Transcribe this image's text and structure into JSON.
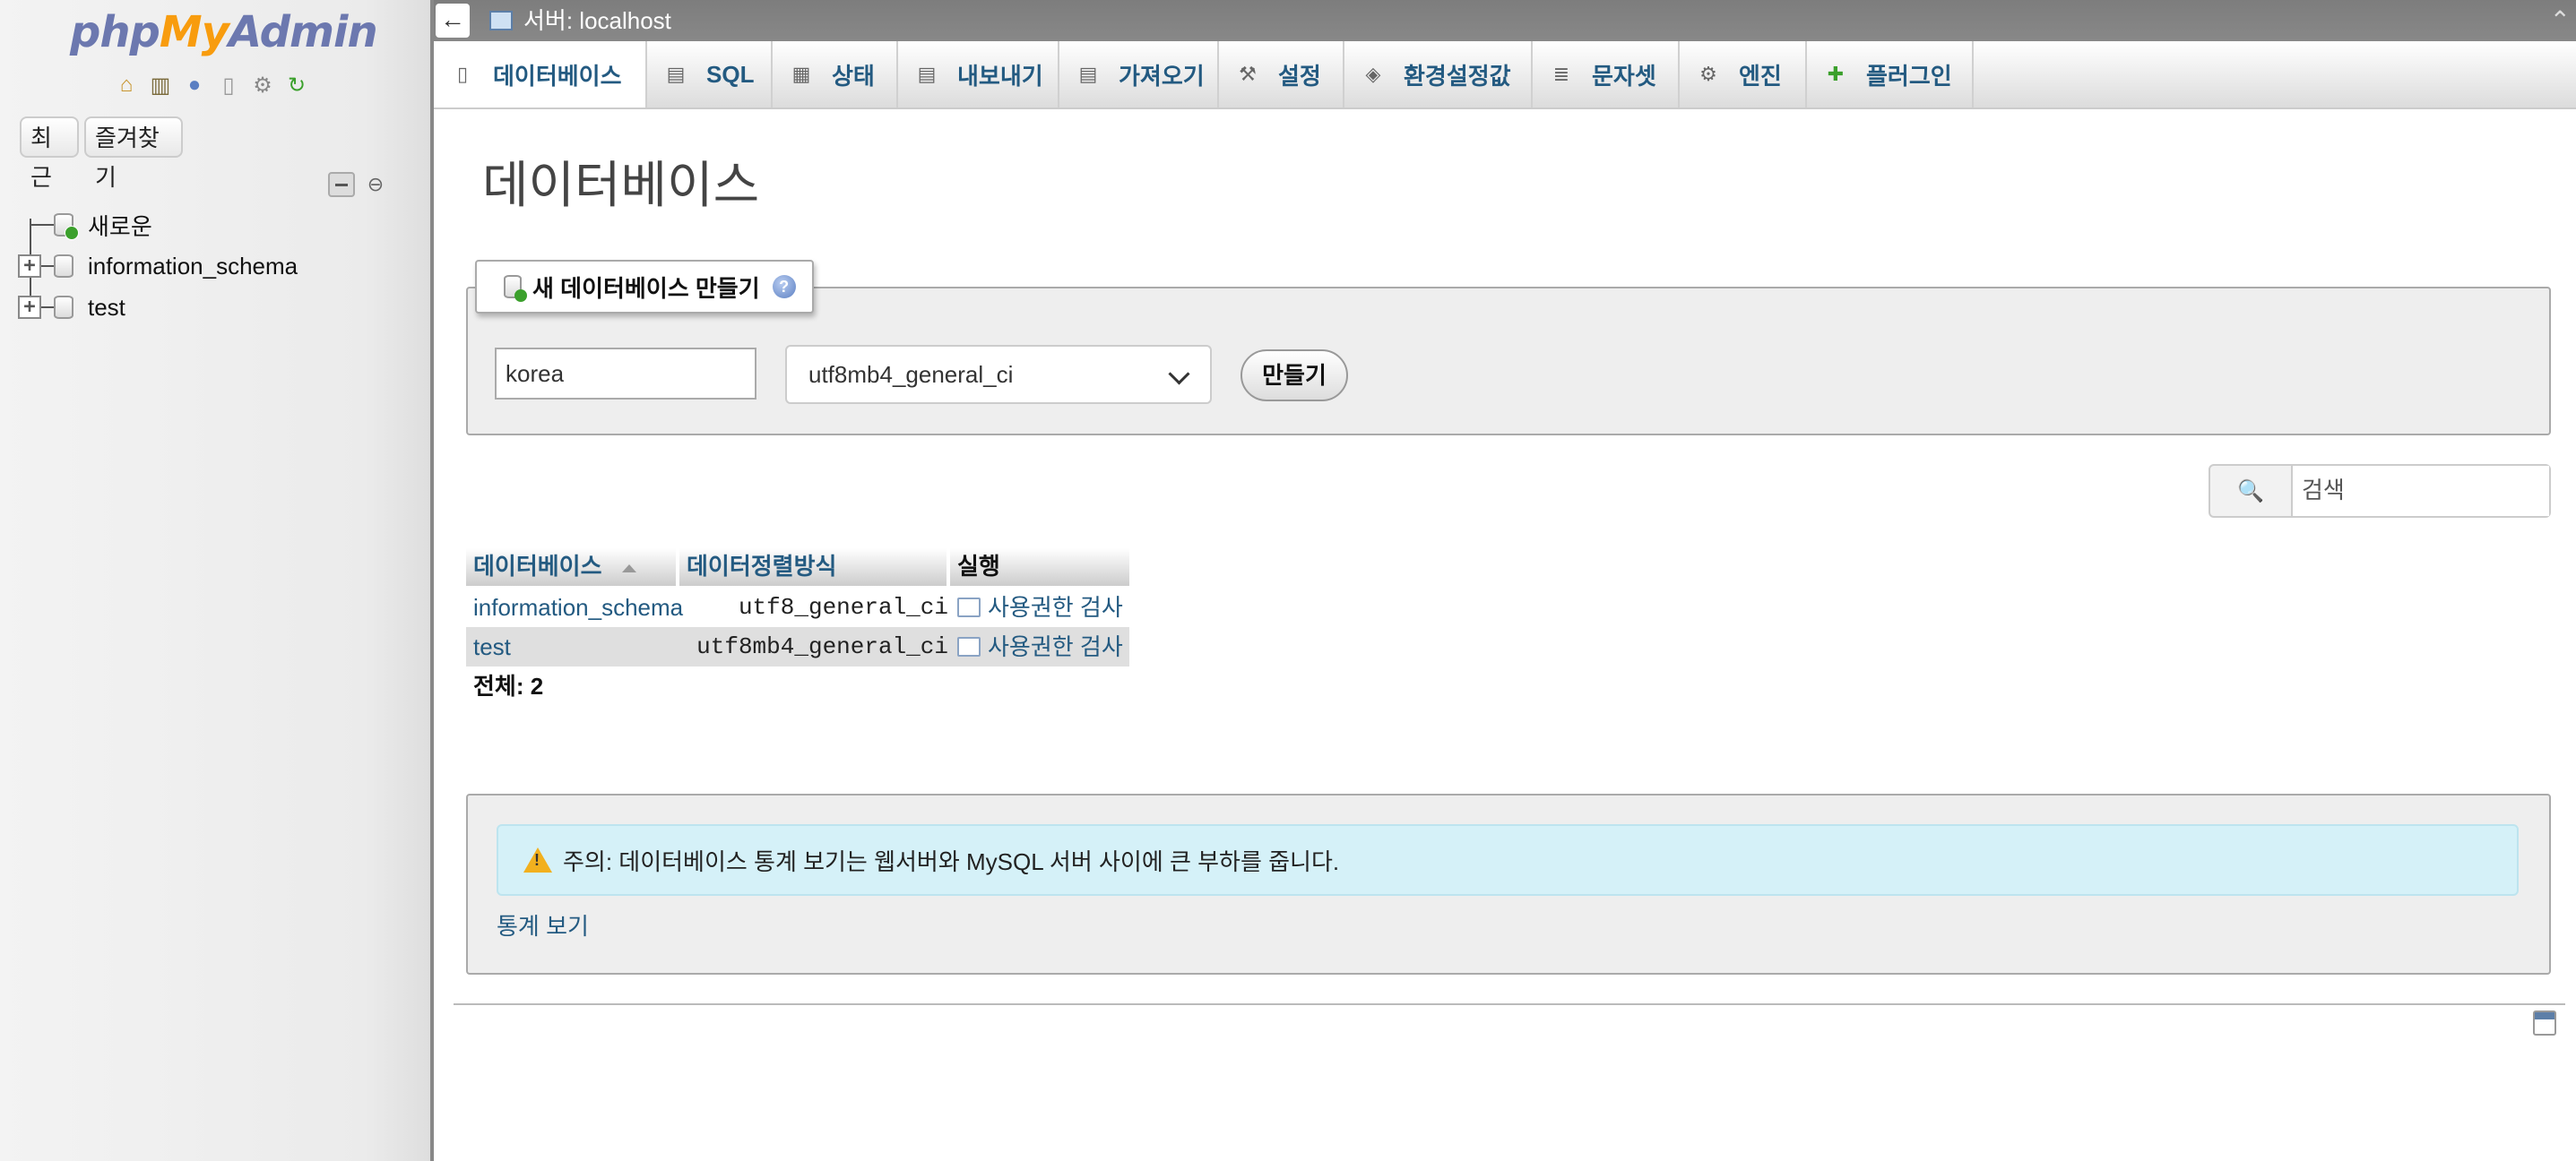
{
  "app": {
    "logo": {
      "part1": "php",
      "part2": "My",
      "part3": "Admin"
    }
  },
  "nav": {
    "icons": [
      "home-icon",
      "logout-icon",
      "help-icon",
      "docs-icon",
      "settings-icon",
      "reload-icon"
    ],
    "recent_label": "최근",
    "favorites_label": "즐겨찾기",
    "tree": [
      {
        "label": "새로운",
        "type": "new"
      },
      {
        "label": "information_schema",
        "type": "db"
      },
      {
        "label": "test",
        "type": "db"
      }
    ]
  },
  "serverbar": {
    "back_glyph": "←",
    "title": "서버: localhost"
  },
  "tabs": [
    {
      "label": "데이터베이스",
      "icon": "database-icon",
      "active": true
    },
    {
      "label": "SQL",
      "icon": "sql-icon"
    },
    {
      "label": "상태",
      "icon": "status-icon"
    },
    {
      "label": "내보내기",
      "icon": "export-icon"
    },
    {
      "label": "가져오기",
      "icon": "import-icon"
    },
    {
      "label": "설정",
      "icon": "wrench-icon"
    },
    {
      "label": "환경설정값",
      "icon": "variables-icon"
    },
    {
      "label": "문자셋",
      "icon": "charset-icon"
    },
    {
      "label": "엔진",
      "icon": "engine-icon"
    },
    {
      "label": "플러그인",
      "icon": "plugin-icon"
    }
  ],
  "main": {
    "title": "데이터베이스",
    "create": {
      "legend": "새 데이터베이스 만들기",
      "db_name_value": "korea",
      "collation_value": "utf8mb4_general_ci",
      "submit_label": "만들기"
    },
    "search": {
      "placeholder": "검색"
    },
    "table": {
      "headers": [
        "데이터베이스",
        "데이터정렬방식",
        "실행"
      ],
      "rows": [
        {
          "name": "information_schema",
          "collation": "utf8_general_ci",
          "action": "사용권한 검사"
        },
        {
          "name": "test",
          "collation": "utf8mb4_general_ci",
          "action": "사용권한 검사"
        }
      ],
      "total": "전체: 2"
    },
    "notice": {
      "text": "주의: 데이터베이스 통계 보기는 웹서버와 MySQL 서버 사이에 큰 부하를 줍니다.",
      "link": "통계 보기"
    }
  }
}
